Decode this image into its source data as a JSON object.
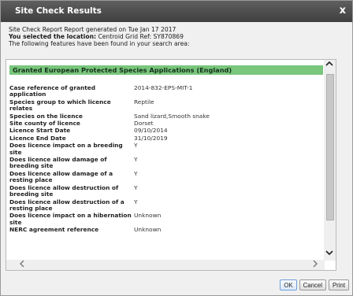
{
  "window": {
    "title": "Site Check Results",
    "close_glyph": "x"
  },
  "intro": {
    "line1": "Site Check Report Report generated on Tue Jan 17 2017",
    "line2_bold": "You selected the location:",
    "line2_rest": "Centroid Grid Ref: SY870869",
    "line3": "The following features have been found in your search area:"
  },
  "section": {
    "title": "Granted European Protected Species Applications (England)",
    "header_color": "#79c67c",
    "rows": [
      {
        "label": "Case reference of granted application",
        "value": "2014-832-EPS-MIT-1"
      },
      {
        "label": "Species group to which licence relates",
        "value": "Reptile"
      },
      {
        "label": "Species on the licence",
        "value": "Sand lizard,Smooth snake"
      },
      {
        "label": "Site county of licence",
        "value": "Dorset"
      },
      {
        "label": "Licence Start Date",
        "value": "09/10/2014"
      },
      {
        "label": "Licence End Date",
        "value": "31/10/2019"
      },
      {
        "label": "Does licence impact on a breeding site",
        "value": "Y"
      },
      {
        "label": "Does licence allow damage of breeding site",
        "value": "Y"
      },
      {
        "label": "Does licence allow damage of a resting place",
        "value": "Y"
      },
      {
        "label": "Does licence allow destruction of breeding site",
        "value": "Y"
      },
      {
        "label": "Does licence allow destruction of a resting place",
        "value": "Y"
      },
      {
        "label": "Does licence impact on a hibernation site",
        "value": "Unknown"
      },
      {
        "label": "NERC agreement reference",
        "value": "Unknown"
      }
    ]
  },
  "buttons": {
    "ok": "OK",
    "cancel": "Cancel",
    "print": "Print"
  },
  "icons": {
    "scroll_up": "chevron-up-icon",
    "scroll_down": "chevron-down-icon",
    "scroll_left": "chevron-left-icon",
    "scroll_right": "chevron-right-icon"
  }
}
